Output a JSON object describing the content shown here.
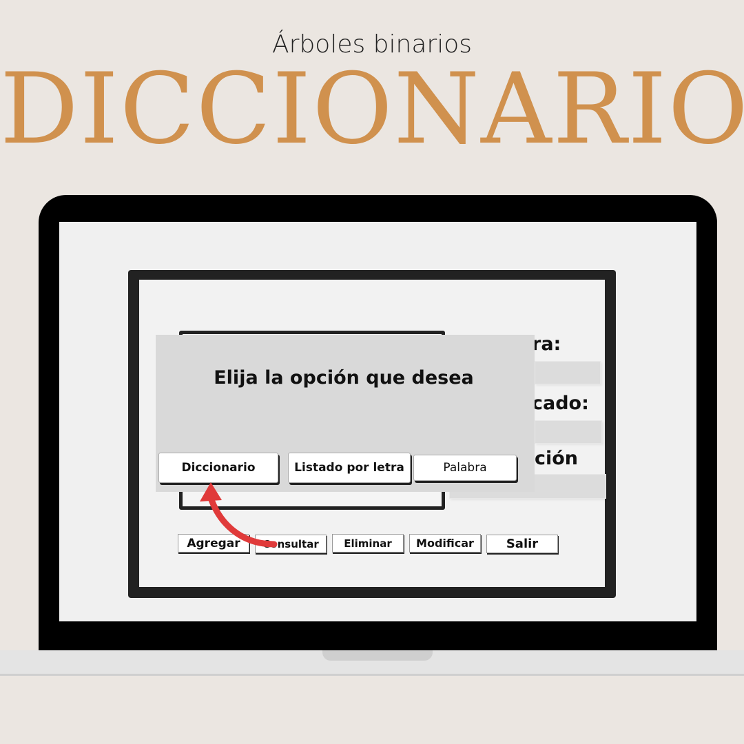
{
  "banner": {
    "subtitle": "Árboles binarios",
    "title": "DICCIONARIO"
  },
  "form": {
    "label_palabra_partial": "ra:",
    "label_significado_partial": "cado:",
    "label_descripcion_partial": "ción"
  },
  "toolbar": {
    "agregar": "Agregar",
    "consultar": "Consultar",
    "eliminar": "Eliminar",
    "modificar": "Modificar",
    "salir": "Salir"
  },
  "dialog": {
    "title": "Elija la opción que desea",
    "option_diccionario": "Diccionario",
    "option_listado": "Listado por letra",
    "option_palabra": "Palabra"
  },
  "colors": {
    "accent": "#d0914e",
    "background": "#ebe6e1",
    "arrow": "#e03a3a"
  }
}
